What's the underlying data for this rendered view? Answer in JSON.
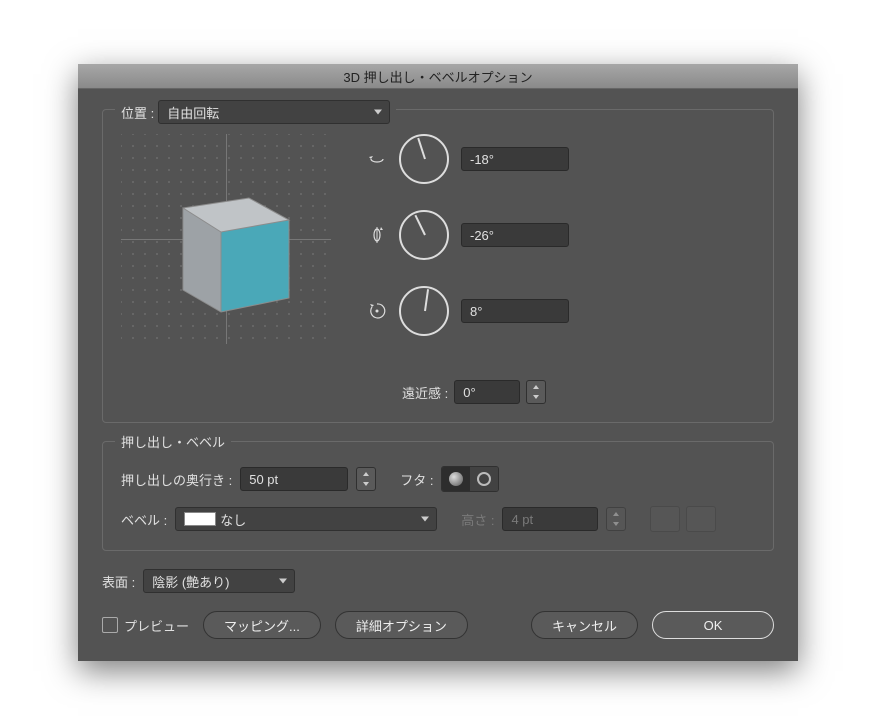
{
  "title": "3D 押し出し・ベベルオプション",
  "position": {
    "label": "位置 :",
    "dropdown": "自由回転",
    "rotX": "-18°",
    "rotY": "-26°",
    "rotZ": "8°",
    "rotX_deg": -18,
    "rotY_deg": -26,
    "rotZ_deg": 8,
    "perspective_label": "遠近感 :",
    "perspective": "0°"
  },
  "extrude": {
    "section_label": "押し出し・ベベル",
    "depth_label": "押し出しの奥行き :",
    "depth": "50 pt",
    "cap_label": "フタ :",
    "bevel_label": "ベベル :",
    "bevel": "なし",
    "height_label": "高さ :",
    "height": "4 pt"
  },
  "surface": {
    "label": "表面 :",
    "value": "陰影 (艶あり)"
  },
  "buttons": {
    "preview": "プレビュー",
    "mapping": "マッピング...",
    "more": "詳細オプション",
    "cancel": "キャンセル",
    "ok": "OK"
  },
  "colors": {
    "cube_front": "#4aa8b8",
    "cube_top": "#c0c4c7",
    "cube_side": "#9da2a6"
  }
}
